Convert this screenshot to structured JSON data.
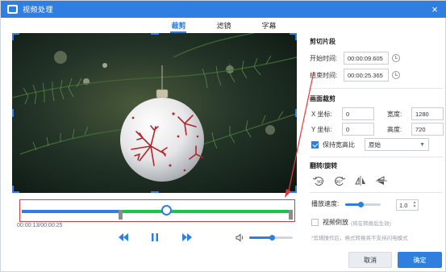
{
  "window": {
    "title": "视频处理",
    "accent_color": "#2f7fe0",
    "highlight_color": "#e23a3a"
  },
  "tabs": [
    {
      "label": "裁剪",
      "active": true
    },
    {
      "label": "滤镜",
      "active": false
    },
    {
      "label": "字幕",
      "active": false
    }
  ],
  "player": {
    "timecode": "00:00:13/00:00:25",
    "trim_start_fraction": 0.37,
    "trim_end_fraction": 0.99,
    "playhead_fraction": 0.52,
    "volume_fraction": 0.52,
    "icons": {
      "rewind": "rewind-icon",
      "pause": "pause-icon",
      "forward": "fast-forward-icon",
      "volume": "volume-icon"
    }
  },
  "clip": {
    "section_title": "剪切片段",
    "start_label": "开始时间:",
    "start_value": "00:00:09.605",
    "end_label": "结束时间:",
    "end_value": "00:00:25.365"
  },
  "crop": {
    "section_title": "画面裁剪",
    "x_label": "X 坐标:",
    "x_value": "0",
    "width_label": "宽度:",
    "width_value": "1280",
    "y_label": "Y 坐标:",
    "y_value": "0",
    "height_label": "高度:",
    "height_value": "720",
    "keep_ratio_label": "保持宽高比",
    "keep_ratio_checked": true,
    "ratio_option": "原始"
  },
  "rotate": {
    "section_title": "翻转/旋转",
    "buttons": [
      "rotate-left-90-icon",
      "rotate-right-90-icon",
      "flip-horizontal-icon",
      "flip-vertical-icon"
    ],
    "labels": [
      "90°",
      "90°"
    ]
  },
  "speed": {
    "label": "播放速度:",
    "value": "1.0",
    "fraction": 0.45
  },
  "reverse": {
    "label": "视频倒放",
    "note": "(将在转换后生效)",
    "checked": false
  },
  "hint": "*剪辑操作后，格式转换将不支持闪电模式",
  "footer": {
    "cancel_label": "取消",
    "ok_label": "确定"
  }
}
